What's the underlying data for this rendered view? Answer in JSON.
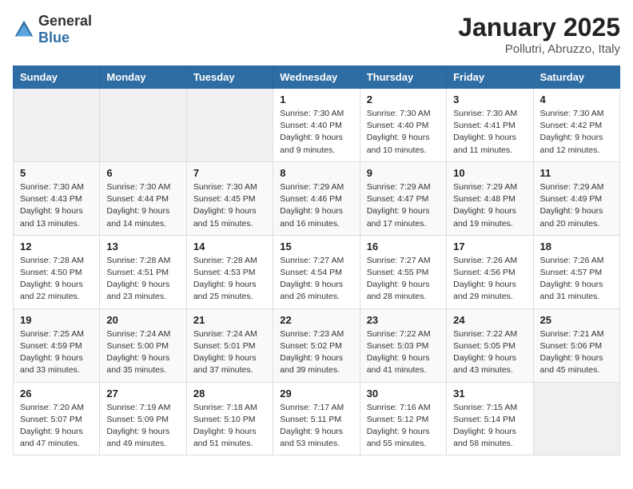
{
  "logo": {
    "general": "General",
    "blue": "Blue"
  },
  "header": {
    "month_year": "January 2025",
    "location": "Pollutri, Abruzzo, Italy"
  },
  "days_of_week": [
    "Sunday",
    "Monday",
    "Tuesday",
    "Wednesday",
    "Thursday",
    "Friday",
    "Saturday"
  ],
  "weeks": [
    [
      {
        "day": "",
        "info": ""
      },
      {
        "day": "",
        "info": ""
      },
      {
        "day": "",
        "info": ""
      },
      {
        "day": "1",
        "info": "Sunrise: 7:30 AM\nSunset: 4:40 PM\nDaylight: 9 hours\nand 9 minutes."
      },
      {
        "day": "2",
        "info": "Sunrise: 7:30 AM\nSunset: 4:40 PM\nDaylight: 9 hours\nand 10 minutes."
      },
      {
        "day": "3",
        "info": "Sunrise: 7:30 AM\nSunset: 4:41 PM\nDaylight: 9 hours\nand 11 minutes."
      },
      {
        "day": "4",
        "info": "Sunrise: 7:30 AM\nSunset: 4:42 PM\nDaylight: 9 hours\nand 12 minutes."
      }
    ],
    [
      {
        "day": "5",
        "info": "Sunrise: 7:30 AM\nSunset: 4:43 PM\nDaylight: 9 hours\nand 13 minutes."
      },
      {
        "day": "6",
        "info": "Sunrise: 7:30 AM\nSunset: 4:44 PM\nDaylight: 9 hours\nand 14 minutes."
      },
      {
        "day": "7",
        "info": "Sunrise: 7:30 AM\nSunset: 4:45 PM\nDaylight: 9 hours\nand 15 minutes."
      },
      {
        "day": "8",
        "info": "Sunrise: 7:29 AM\nSunset: 4:46 PM\nDaylight: 9 hours\nand 16 minutes."
      },
      {
        "day": "9",
        "info": "Sunrise: 7:29 AM\nSunset: 4:47 PM\nDaylight: 9 hours\nand 17 minutes."
      },
      {
        "day": "10",
        "info": "Sunrise: 7:29 AM\nSunset: 4:48 PM\nDaylight: 9 hours\nand 19 minutes."
      },
      {
        "day": "11",
        "info": "Sunrise: 7:29 AM\nSunset: 4:49 PM\nDaylight: 9 hours\nand 20 minutes."
      }
    ],
    [
      {
        "day": "12",
        "info": "Sunrise: 7:28 AM\nSunset: 4:50 PM\nDaylight: 9 hours\nand 22 minutes."
      },
      {
        "day": "13",
        "info": "Sunrise: 7:28 AM\nSunset: 4:51 PM\nDaylight: 9 hours\nand 23 minutes."
      },
      {
        "day": "14",
        "info": "Sunrise: 7:28 AM\nSunset: 4:53 PM\nDaylight: 9 hours\nand 25 minutes."
      },
      {
        "day": "15",
        "info": "Sunrise: 7:27 AM\nSunset: 4:54 PM\nDaylight: 9 hours\nand 26 minutes."
      },
      {
        "day": "16",
        "info": "Sunrise: 7:27 AM\nSunset: 4:55 PM\nDaylight: 9 hours\nand 28 minutes."
      },
      {
        "day": "17",
        "info": "Sunrise: 7:26 AM\nSunset: 4:56 PM\nDaylight: 9 hours\nand 29 minutes."
      },
      {
        "day": "18",
        "info": "Sunrise: 7:26 AM\nSunset: 4:57 PM\nDaylight: 9 hours\nand 31 minutes."
      }
    ],
    [
      {
        "day": "19",
        "info": "Sunrise: 7:25 AM\nSunset: 4:59 PM\nDaylight: 9 hours\nand 33 minutes."
      },
      {
        "day": "20",
        "info": "Sunrise: 7:24 AM\nSunset: 5:00 PM\nDaylight: 9 hours\nand 35 minutes."
      },
      {
        "day": "21",
        "info": "Sunrise: 7:24 AM\nSunset: 5:01 PM\nDaylight: 9 hours\nand 37 minutes."
      },
      {
        "day": "22",
        "info": "Sunrise: 7:23 AM\nSunset: 5:02 PM\nDaylight: 9 hours\nand 39 minutes."
      },
      {
        "day": "23",
        "info": "Sunrise: 7:22 AM\nSunset: 5:03 PM\nDaylight: 9 hours\nand 41 minutes."
      },
      {
        "day": "24",
        "info": "Sunrise: 7:22 AM\nSunset: 5:05 PM\nDaylight: 9 hours\nand 43 minutes."
      },
      {
        "day": "25",
        "info": "Sunrise: 7:21 AM\nSunset: 5:06 PM\nDaylight: 9 hours\nand 45 minutes."
      }
    ],
    [
      {
        "day": "26",
        "info": "Sunrise: 7:20 AM\nSunset: 5:07 PM\nDaylight: 9 hours\nand 47 minutes."
      },
      {
        "day": "27",
        "info": "Sunrise: 7:19 AM\nSunset: 5:09 PM\nDaylight: 9 hours\nand 49 minutes."
      },
      {
        "day": "28",
        "info": "Sunrise: 7:18 AM\nSunset: 5:10 PM\nDaylight: 9 hours\nand 51 minutes."
      },
      {
        "day": "29",
        "info": "Sunrise: 7:17 AM\nSunset: 5:11 PM\nDaylight: 9 hours\nand 53 minutes."
      },
      {
        "day": "30",
        "info": "Sunrise: 7:16 AM\nSunset: 5:12 PM\nDaylight: 9 hours\nand 55 minutes."
      },
      {
        "day": "31",
        "info": "Sunrise: 7:15 AM\nSunset: 5:14 PM\nDaylight: 9 hours\nand 58 minutes."
      },
      {
        "day": "",
        "info": ""
      }
    ]
  ]
}
